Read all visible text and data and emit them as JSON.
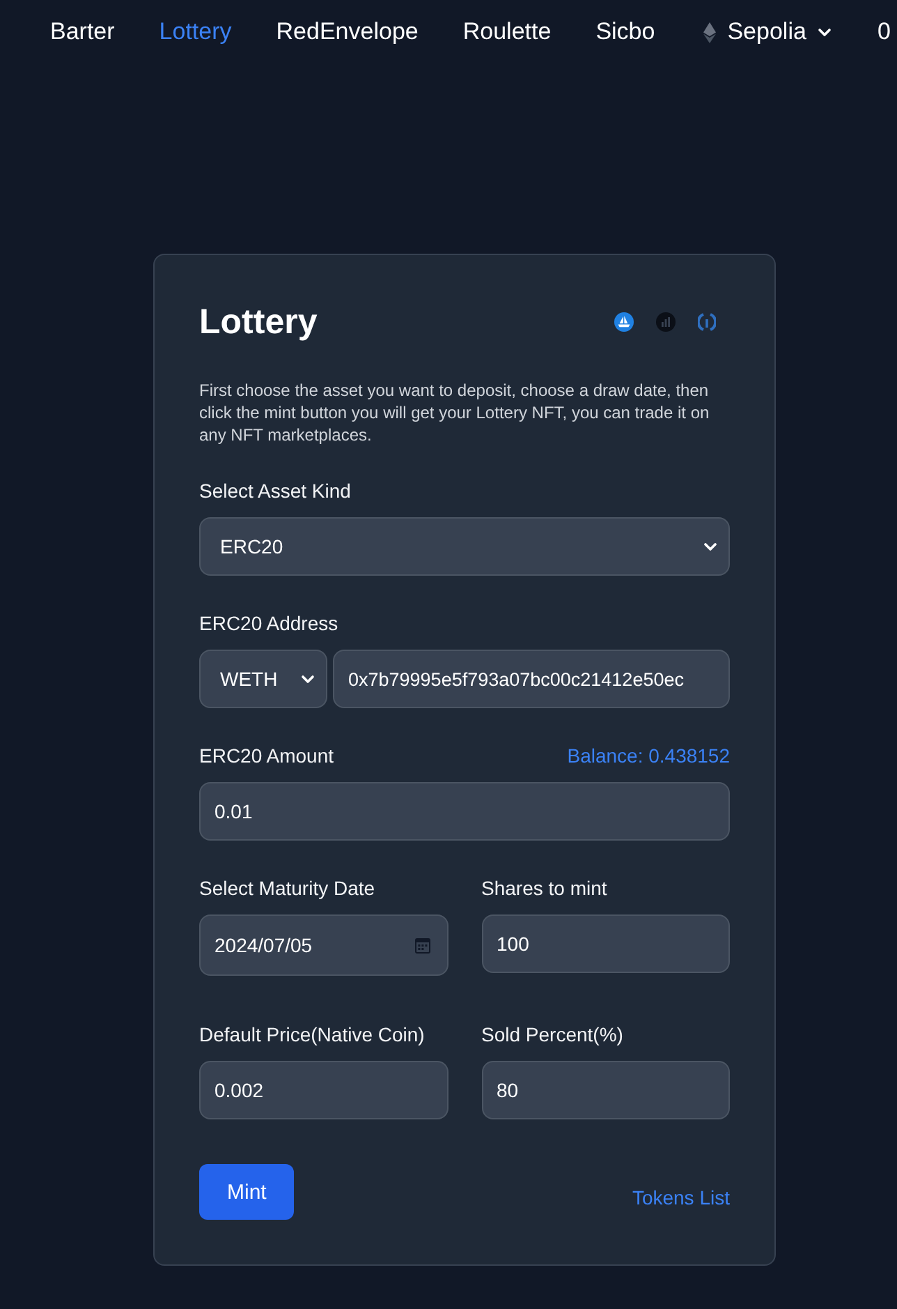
{
  "nav": {
    "items": [
      {
        "label": "Barter",
        "selected": false
      },
      {
        "label": "Lottery",
        "selected": true
      },
      {
        "label": "RedEnvelope",
        "selected": false
      },
      {
        "label": "Roulette",
        "selected": false
      },
      {
        "label": "Sicbo",
        "selected": false
      }
    ],
    "network": {
      "label": "Sepolia"
    },
    "account": {
      "label": "0"
    }
  },
  "card": {
    "title": "Lottery",
    "description": "First choose the asset you want to deposit, choose a draw date, then click the mint button you will get your Lottery NFT, you can trade it on any NFT marketplaces.",
    "form": [
      {
        "kind": "select",
        "label": "Select Asset Kind",
        "value": "ERC20"
      },
      {
        "kind": "token_address",
        "label": "ERC20 Address",
        "token": "WETH",
        "value": "0x7b79995e5f793a07bc00c21412e50ec"
      },
      {
        "kind": "amount",
        "label": "ERC20 Amount",
        "balance": "Balance: 0.438152",
        "value": "0.01"
      },
      {
        "kind": "pair",
        "fields": [
          {
            "kind": "date",
            "label": "Select Maturity Date",
            "value": "2024/07/05"
          },
          {
            "kind": "number",
            "label": "Shares to mint",
            "value": "100"
          }
        ]
      },
      {
        "kind": "pair",
        "fields": [
          {
            "kind": "number",
            "label": "Default Price(Native Coin)",
            "value": "0.002"
          },
          {
            "kind": "number",
            "label": "Sold Percent(%)",
            "value": "80"
          }
        ]
      }
    ],
    "mint_button": {
      "label": "Mint"
    },
    "tokens_link": {
      "label": "Tokens List"
    }
  }
}
